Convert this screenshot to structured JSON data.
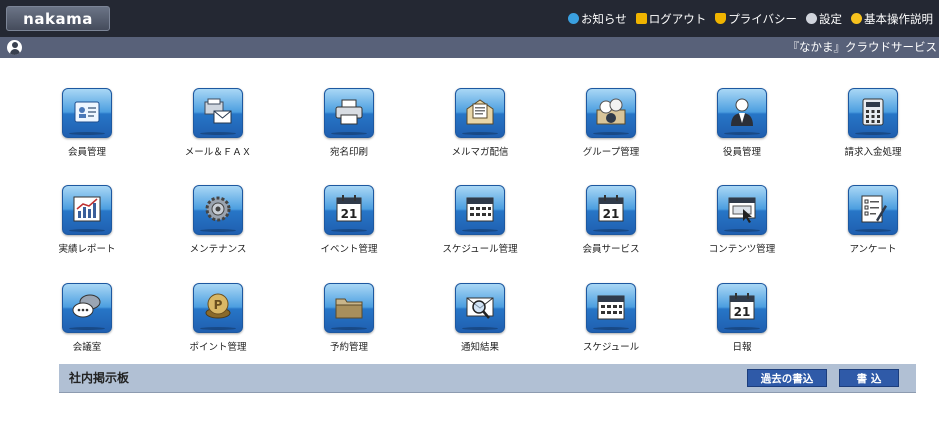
{
  "app": {
    "logo": "nakama"
  },
  "topnav": {
    "items": [
      {
        "label": "お知らせ",
        "icon": "info-icon",
        "color": "#3aa0e0"
      },
      {
        "label": "ログアウト",
        "icon": "lock-icon",
        "color": "#f0b400"
      },
      {
        "label": "プライバシー",
        "icon": "shield-icon",
        "color": "#f0b400"
      },
      {
        "label": "設定",
        "icon": "gear-icon",
        "color": "#d0d4dc"
      },
      {
        "label": "基本操作説明",
        "icon": "lightbulb-icon",
        "color": "#f7c21e"
      }
    ]
  },
  "subbar": {
    "service_title": "『なかま』クラウドサービス"
  },
  "menu": {
    "row1": [
      {
        "label": "会員管理",
        "icon": "member-card-icon"
      },
      {
        "label": "メール＆ＦＡＸ",
        "icon": "fax-mail-icon"
      },
      {
        "label": "宛名印刷",
        "icon": "printer-icon"
      },
      {
        "label": "メルマガ配信",
        "icon": "newsletter-icon"
      },
      {
        "label": "グループ管理",
        "icon": "group-icon"
      },
      {
        "label": "役員管理",
        "icon": "executive-icon"
      },
      {
        "label": "請求入金処理",
        "icon": "calculator-icon"
      }
    ],
    "row2": [
      {
        "label": "実績レポート",
        "icon": "report-chart-icon"
      },
      {
        "label": "メンテナンス",
        "icon": "gears-icon"
      },
      {
        "label": "イベント管理",
        "icon": "calendar-icon",
        "day": "21"
      },
      {
        "label": "スケジュール管理",
        "icon": "schedule-grid-icon"
      },
      {
        "label": "会員サービス",
        "icon": "calendar-icon",
        "day": "21"
      },
      {
        "label": "コンテンツ管理",
        "icon": "content-window-icon"
      },
      {
        "label": "アンケート",
        "icon": "survey-icon"
      }
    ],
    "row3": [
      {
        "label": "会議室",
        "icon": "chat-bubbles-icon"
      },
      {
        "label": "ポイント管理",
        "icon": "point-coin-icon"
      },
      {
        "label": "予約管理",
        "icon": "folder-icon"
      },
      {
        "label": "通知結果",
        "icon": "envelope-search-icon"
      },
      {
        "label": "スケジュール",
        "icon": "schedule-grid-icon"
      },
      {
        "label": "日報",
        "icon": "calendar-icon",
        "day": "21"
      }
    ]
  },
  "board": {
    "title": "社内掲示板",
    "past_label": "過去の書込",
    "write_label": "書 込"
  }
}
